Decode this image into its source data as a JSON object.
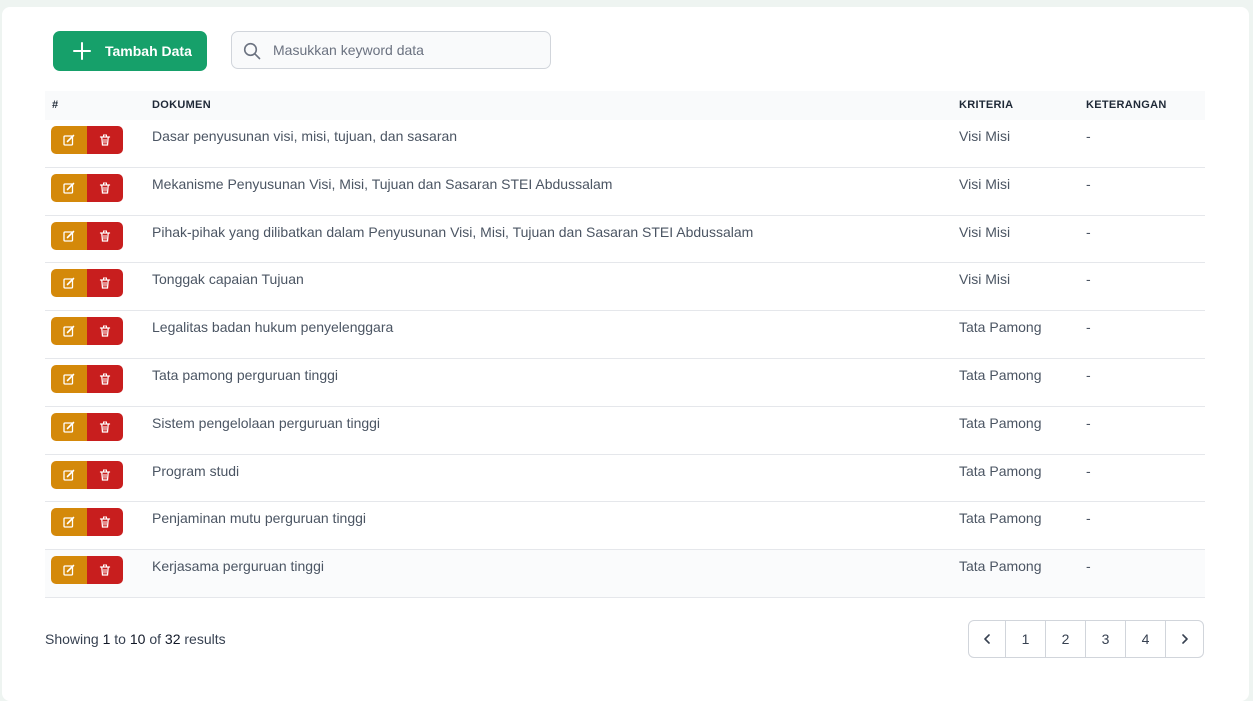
{
  "toolbar": {
    "add_label": "Tambah Data",
    "search_placeholder": "Masukkan keyword data"
  },
  "table": {
    "headers": [
      "#",
      "DOKUMEN",
      "KRITERIA",
      "KETERANGAN"
    ],
    "rows": [
      {
        "dokumen": "Dasar penyusunan visi, misi, tujuan, dan sasaran",
        "kriteria": "Visi Misi",
        "keterangan": "-"
      },
      {
        "dokumen": "Mekanisme Penyusunan Visi, Misi, Tujuan dan Sasaran STEI Abdussalam",
        "kriteria": "Visi Misi",
        "keterangan": "-"
      },
      {
        "dokumen": "Pihak-pihak yang dilibatkan dalam Penyusunan Visi, Misi, Tujuan dan Sasaran STEI Abdussalam",
        "kriteria": "Visi Misi",
        "keterangan": "-"
      },
      {
        "dokumen": "Tonggak capaian Tujuan",
        "kriteria": "Visi Misi",
        "keterangan": "-"
      },
      {
        "dokumen": "Legalitas badan hukum penyelenggara",
        "kriteria": "Tata Pamong",
        "keterangan": "-"
      },
      {
        "dokumen": "Tata pamong perguruan tinggi",
        "kriteria": "Tata Pamong",
        "keterangan": "-"
      },
      {
        "dokumen": "Sistem pengelolaan perguruan tinggi",
        "kriteria": "Tata Pamong",
        "keterangan": "-"
      },
      {
        "dokumen": "Program studi",
        "kriteria": "Tata Pamong",
        "keterangan": "-"
      },
      {
        "dokumen": "Penjaminan mutu perguruan tinggi",
        "kriteria": "Tata Pamong",
        "keterangan": "-"
      },
      {
        "dokumen": "Kerjasama perguruan tinggi",
        "kriteria": "Tata Pamong",
        "keterangan": "-"
      }
    ]
  },
  "footer": {
    "showing_prefix": "Showing",
    "from": "1",
    "to_word": "to",
    "to": "10",
    "of_word": "of",
    "total": "32",
    "results_word": "results"
  },
  "pagination": {
    "prev_icon": "chevron-left-icon",
    "next_icon": "chevron-right-icon",
    "pages": [
      "1",
      "2",
      "3",
      "4"
    ]
  },
  "icons": {
    "add": "plus-icon",
    "search": "search-icon",
    "edit": "edit-icon",
    "delete": "trash-icon"
  },
  "colors": {
    "primary": "#16a06a",
    "edit": "#d4890a",
    "delete": "#c81e1e"
  }
}
